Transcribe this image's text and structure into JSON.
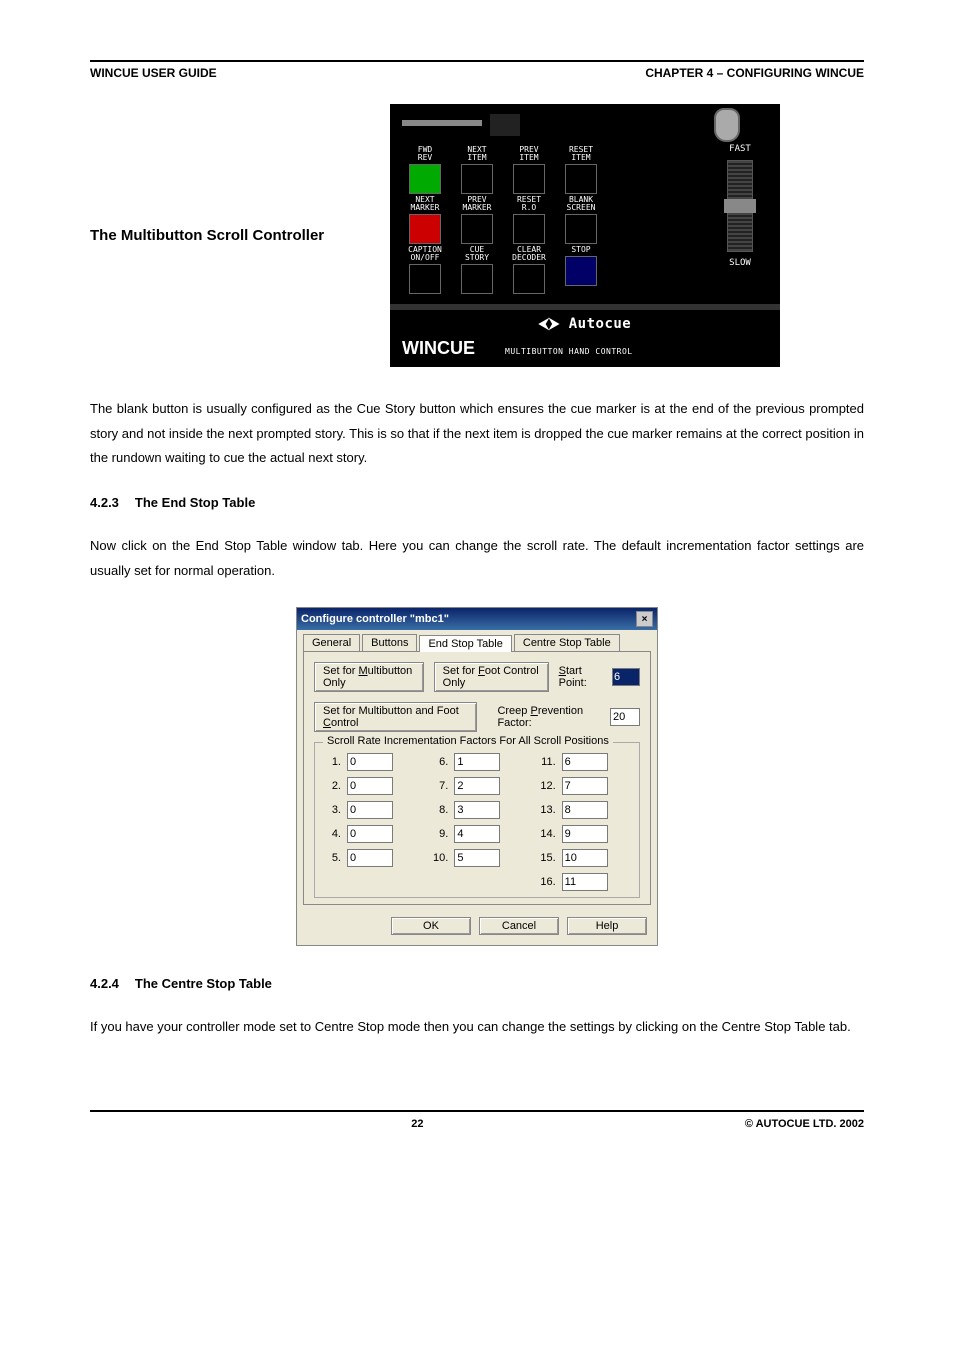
{
  "header": {
    "left": "WINCUE USER GUIDE",
    "right": "CHAPTER 4 – CONFIGURING WINCUE"
  },
  "figure1": {
    "caption": "The Multibutton Scroll Controller",
    "buttons": {
      "r1": [
        "FWD\nREV",
        "NEXT\nITEM",
        "PREV\nITEM",
        "RESET\nITEM"
      ],
      "r2": [
        "NEXT\nMARKER",
        "PREV\nMARKER",
        "RESET\nR.O",
        "BLANK\nSCREEN"
      ],
      "r3": [
        "CAPTION\nON/OFF",
        "CUE\nSTORY",
        "CLEAR\nDECODER",
        "STOP"
      ]
    },
    "speed": {
      "fast": "FAST",
      "slow": "SLOW"
    },
    "brand": {
      "autocue": "Autocue",
      "wincue": "WINCUE",
      "sub": "MULTIBUTTON HAND CONTROL"
    }
  },
  "para1": "The blank button is usually configured as the Cue Story button which ensures the cue marker is at the end of the previous prompted story and not inside the next prompted story. This is so that if the next item is dropped the cue marker remains at the correct position in the rundown waiting to cue the actual next story.",
  "section423": {
    "num": "4.2.3",
    "title": "The End Stop Table"
  },
  "para2": "Now click on the End Stop Table window tab.  Here you can change the scroll rate. The default incrementation factor settings are usually set for normal operation.",
  "dialog": {
    "title": "Configure controller \"mbc1\"",
    "tabs": [
      "General",
      "Buttons",
      "End Stop Table",
      "Centre Stop Table"
    ],
    "active_tab": 2,
    "btn_multi": "Set for Multibutton Only",
    "btn_foot": "Set for Foot Control Only",
    "start_point_label": "Start Point:",
    "start_point": "6",
    "btn_multi_foot": "Set for Multibutton and Foot Control",
    "creep_label": "Creep Prevention Factor:",
    "creep": "20",
    "groupbox": "Scroll Rate Incrementation Factors For All Scroll Positions",
    "positions": {
      "1": "0",
      "2": "0",
      "3": "0",
      "4": "0",
      "5": "0",
      "6": "1",
      "7": "2",
      "8": "3",
      "9": "4",
      "10": "5",
      "11": "6",
      "12": "7",
      "13": "8",
      "14": "9",
      "15": "10",
      "16": "11"
    },
    "ok": "OK",
    "cancel": "Cancel",
    "help": "Help"
  },
  "section424": {
    "num": "4.2.4",
    "title": "The Centre Stop Table"
  },
  "para3": "If you have your controller mode set to Centre Stop mode then you can change the settings by clicking on the Centre Stop Table tab.",
  "footer": {
    "page": "22",
    "copyright": "© AUTOCUE  LTD.  2002"
  }
}
